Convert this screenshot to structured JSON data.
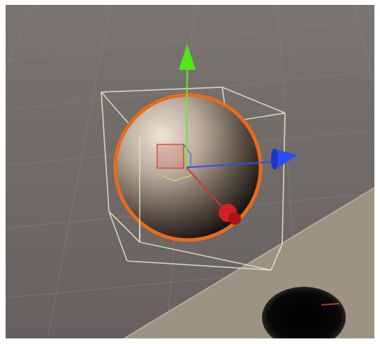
{
  "colors": {
    "background": "#6e6864",
    "floor": "#9c9282",
    "grid_line": "#807a76",
    "selection_outline": "#e96a1a",
    "bounds_box": "#dfe8c8",
    "axis_y": "#5ae81e",
    "axis_z": "#2b4cf2",
    "axis_x": "#e02424",
    "collider_ring": "#c9e07a"
  },
  "scene": {
    "selected_object": "sphere",
    "gizmo": "translate-gizmo"
  }
}
